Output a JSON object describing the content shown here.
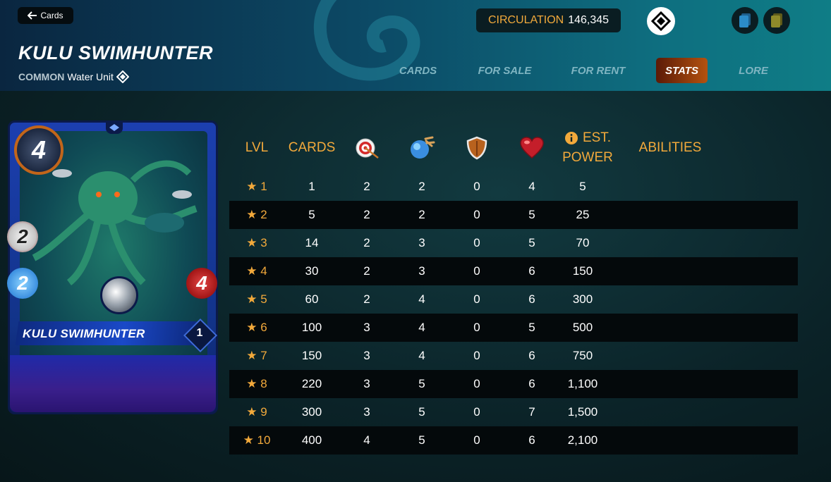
{
  "header": {
    "back_label": "Cards",
    "title": "KULU SWIMHUNTER",
    "rarity": "COMMON",
    "type_text": "Water Unit",
    "circulation_label": "CIRCULATION",
    "circulation_value": "146,345"
  },
  "nav": {
    "tabs": [
      {
        "label": "CARDS"
      },
      {
        "label": "FOR SALE"
      },
      {
        "label": "FOR RENT"
      },
      {
        "label": "STATS",
        "active": true
      },
      {
        "label": "LORE"
      }
    ]
  },
  "card": {
    "name": "KULU SWIMHUNTER",
    "mana": "4",
    "ranged": "2",
    "speed": "2",
    "health": "4",
    "level": "1"
  },
  "table": {
    "headers": {
      "lvl": "LVL",
      "cards": "CARDS",
      "ranged_icon": "ranged-attack-icon",
      "speed_icon": "speed-icon",
      "armor_icon": "armor-icon",
      "health_icon": "health-icon",
      "power_line1": "EST.",
      "power_line2": "POWER",
      "abilities": "ABILITIES"
    },
    "rows": [
      {
        "lvl": "★ 1",
        "cards": "1",
        "ranged": "2",
        "speed": "2",
        "armor": "0",
        "health": "4",
        "power": "5"
      },
      {
        "lvl": "★ 2",
        "cards": "5",
        "ranged": "2",
        "speed": "2",
        "armor": "0",
        "health": "5",
        "power": "25"
      },
      {
        "lvl": "★ 3",
        "cards": "14",
        "ranged": "2",
        "speed": "3",
        "armor": "0",
        "health": "5",
        "power": "70"
      },
      {
        "lvl": "★ 4",
        "cards": "30",
        "ranged": "2",
        "speed": "3",
        "armor": "0",
        "health": "6",
        "power": "150"
      },
      {
        "lvl": "★ 5",
        "cards": "60",
        "ranged": "2",
        "speed": "4",
        "armor": "0",
        "health": "6",
        "power": "300"
      },
      {
        "lvl": "★ 6",
        "cards": "100",
        "ranged": "3",
        "speed": "4",
        "armor": "0",
        "health": "5",
        "power": "500"
      },
      {
        "lvl": "★ 7",
        "cards": "150",
        "ranged": "3",
        "speed": "4",
        "armor": "0",
        "health": "6",
        "power": "750"
      },
      {
        "lvl": "★ 8",
        "cards": "220",
        "ranged": "3",
        "speed": "5",
        "armor": "0",
        "health": "6",
        "power": "1,100"
      },
      {
        "lvl": "★ 9",
        "cards": "300",
        "ranged": "3",
        "speed": "5",
        "armor": "0",
        "health": "7",
        "power": "1,500"
      },
      {
        "lvl": "★ 10",
        "cards": "400",
        "ranged": "4",
        "speed": "5",
        "armor": "0",
        "health": "6",
        "power": "2,100"
      }
    ]
  },
  "colors": {
    "accent_orange": "#f2a93b",
    "active_tab": "#b4520f"
  }
}
